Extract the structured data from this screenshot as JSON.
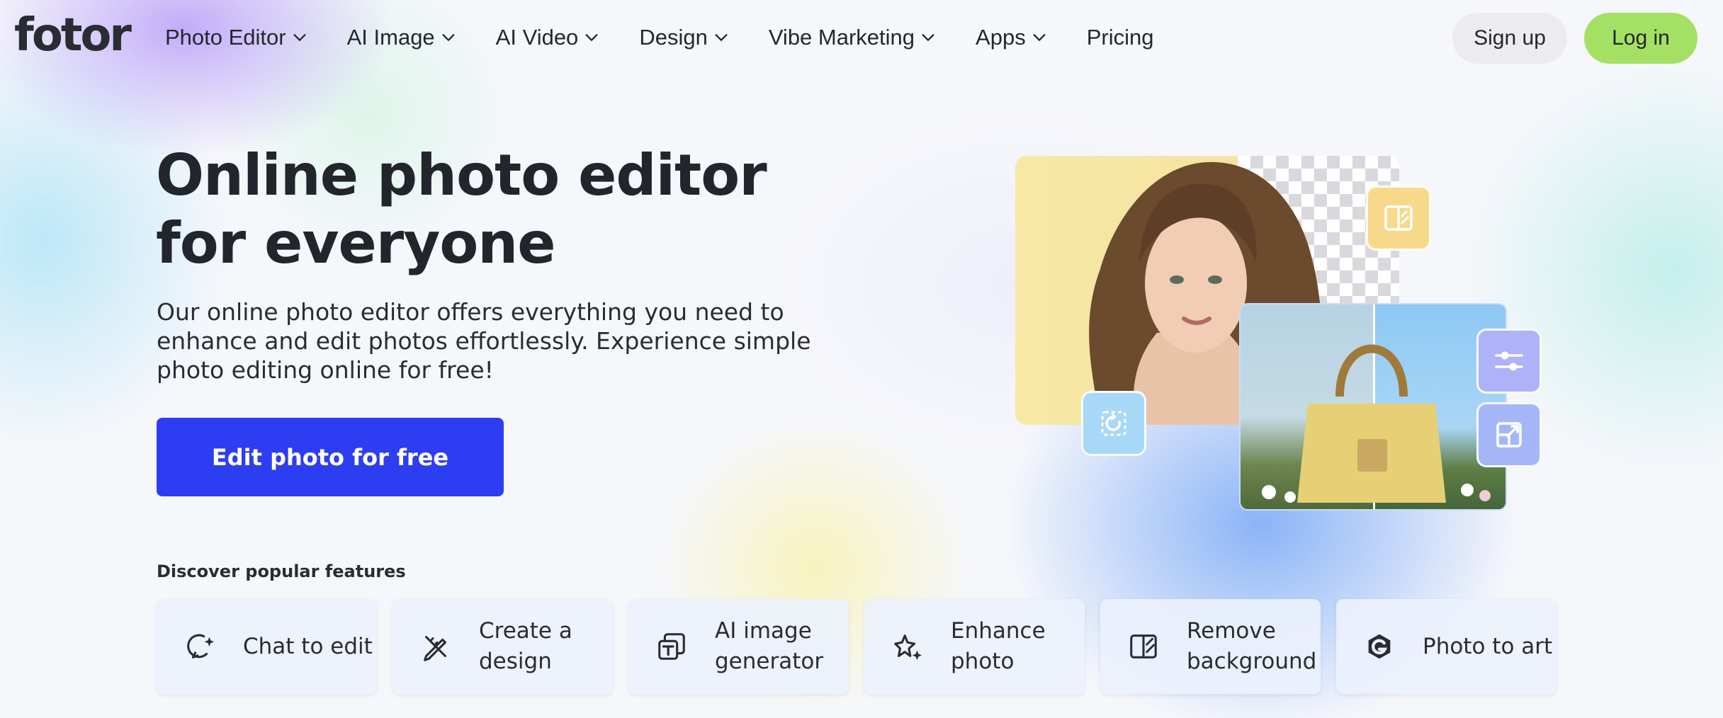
{
  "brand": {
    "logo_text": "fotor"
  },
  "nav": {
    "items": [
      {
        "label": "Photo Editor",
        "has_dropdown": true
      },
      {
        "label": "AI Image",
        "has_dropdown": true
      },
      {
        "label": "AI Video",
        "has_dropdown": true
      },
      {
        "label": "Design",
        "has_dropdown": true
      },
      {
        "label": "Vibe Marketing",
        "has_dropdown": true
      },
      {
        "label": "Apps",
        "has_dropdown": true
      },
      {
        "label": "Pricing",
        "has_dropdown": false
      }
    ],
    "signup_label": "Sign up",
    "login_label": "Log in"
  },
  "hero": {
    "title": "Online photo editor for everyone",
    "subtitle": "Our online photo editor offers everything you need to enhance and edit photos effortlessly. Experience simple photo editing online for free!",
    "cta_label": "Edit photo for free"
  },
  "features": {
    "heading": "Discover popular features",
    "items": [
      {
        "label": "Chat to edit",
        "icon": "chat-sparkle-icon"
      },
      {
        "label": "Create a design",
        "icon": "design-tools-icon"
      },
      {
        "label": "AI image generator",
        "icon": "ai-text-image-icon"
      },
      {
        "label": "Enhance photo",
        "icon": "sparkle-enhance-icon"
      },
      {
        "label": "Remove background",
        "icon": "remove-bg-icon"
      },
      {
        "label": "Photo to art",
        "icon": "art-g-icon"
      }
    ]
  },
  "colors": {
    "cta": "#2d3df2",
    "login": "#a4e063",
    "signup": "#ececee",
    "text": "#23252c"
  }
}
